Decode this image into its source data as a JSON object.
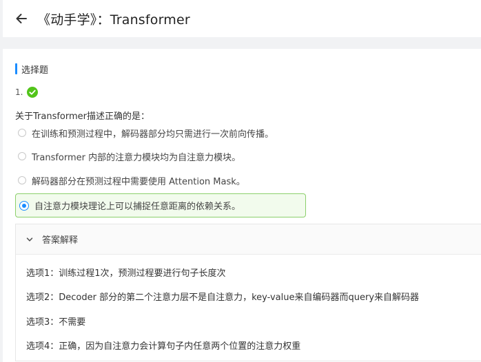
{
  "header": {
    "title": "《动手学》：Transformer",
    "back_icon": "arrow-left-icon"
  },
  "section": {
    "title": "选择题",
    "accent_color": "#1a8cff"
  },
  "question": {
    "number": "1.",
    "status_icon": "check-circle-icon",
    "status_color": "#52c41a",
    "text": "关于Transformer描述正确的是："
  },
  "options": [
    {
      "label": "在训练和预测过程中，解码器部分均只需进行一次前向传播。",
      "selected": false
    },
    {
      "label": "Transformer 内部的注意力模块均为自注意力模块。",
      "selected": false
    },
    {
      "label": "解码器部分在预测过程中需要使用 Attention Mask。",
      "selected": false
    },
    {
      "label": "自注意力模块理论上可以捕捉任意距离的依赖关系。",
      "selected": true
    }
  ],
  "answer": {
    "header_label": "答案解释",
    "explanations": [
      "选项1：训练过程1次，预测过程要进行句子长度次",
      "选项2：Decoder 部分的第二个注意力层不是自注意力，key-value来自编码器而query来自解码器",
      "选项3：不需要",
      "选项4：正确，因为自注意力会计算句子内任意两个位置的注意力权重"
    ]
  }
}
